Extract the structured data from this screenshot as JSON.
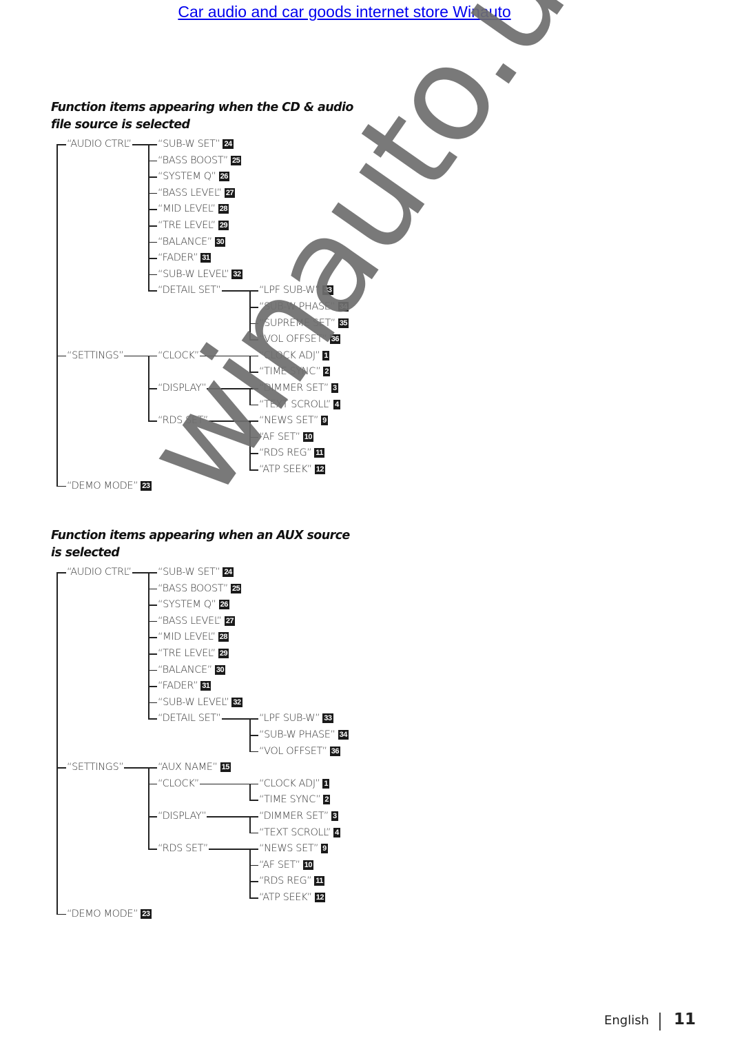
{
  "header": {
    "store_link": "Car audio and car goods internet store Winauto"
  },
  "watermark": "winauto.ua",
  "sections": [
    {
      "title_line1": "Function items appearing when the CD & audio",
      "title_line2": "file source is selected",
      "tree": [
        {
          "label": "“AUDIO CTRL”",
          "children": [
            {
              "label": "“SUB-W SET”",
              "ref": "24"
            },
            {
              "label": "“BASS BOOST”",
              "ref": "25"
            },
            {
              "label": "“SYSTEM Q”",
              "ref": "26"
            },
            {
              "label": "“BASS LEVEL”",
              "ref": "27"
            },
            {
              "label": "“MID LEVEL”",
              "ref": "28"
            },
            {
              "label": "“TRE LEVEL”",
              "ref": "29"
            },
            {
              "label": "“BALANCE”",
              "ref": "30"
            },
            {
              "label": "“FADER”",
              "ref": "31"
            },
            {
              "label": "“SUB-W LEVEL”",
              "ref": "32"
            },
            {
              "label": "“DETAIL SET”",
              "children": [
                {
                  "label": "“LPF SUB-W”",
                  "ref": "33"
                },
                {
                  "label": "“SUB-W PHASE”",
                  "ref": "34"
                },
                {
                  "label": "“SUPREME SET”",
                  "ref": "35"
                },
                {
                  "label": "“VOL OFFSET”",
                  "ref": "36"
                }
              ]
            }
          ]
        },
        {
          "label": "“SETTINGS”",
          "children": [
            {
              "label": "“CLOCK”",
              "children": [
                {
                  "label": "“CLOCK ADJ”",
                  "ref": "1"
                },
                {
                  "label": "“TIME SYNC”",
                  "ref": "2"
                }
              ]
            },
            {
              "label": "“DISPLAY”",
              "children": [
                {
                  "label": "“DIMMER SET”",
                  "ref": "3"
                },
                {
                  "label": "“TEXT SCROLL”",
                  "ref": "4"
                }
              ]
            },
            {
              "label": "“RDS SET”",
              "children": [
                {
                  "label": "“NEWS SET”",
                  "ref": "9"
                },
                {
                  "label": "“AF SET”",
                  "ref": "10"
                },
                {
                  "label": "“RDS REG”",
                  "ref": "11"
                },
                {
                  "label": "“ATP SEEK”",
                  "ref": "12"
                }
              ]
            }
          ]
        },
        {
          "label": "“DEMO MODE”",
          "ref": "23"
        }
      ]
    },
    {
      "title_line1": "Function items appearing when an AUX source",
      "title_line2": "is selected",
      "tree": [
        {
          "label": "“AUDIO CTRL”",
          "children": [
            {
              "label": "“SUB-W SET”",
              "ref": "24"
            },
            {
              "label": "“BASS BOOST”",
              "ref": "25"
            },
            {
              "label": "“SYSTEM Q”",
              "ref": "26"
            },
            {
              "label": "“BASS LEVEL”",
              "ref": "27"
            },
            {
              "label": "“MID LEVEL”",
              "ref": "28"
            },
            {
              "label": "“TRE LEVEL”",
              "ref": "29"
            },
            {
              "label": "“BALANCE”",
              "ref": "30"
            },
            {
              "label": "“FADER”",
              "ref": "31"
            },
            {
              "label": "“SUB-W LEVEL”",
              "ref": "32"
            },
            {
              "label": "“DETAIL SET”",
              "children": [
                {
                  "label": "“LPF SUB-W”",
                  "ref": "33"
                },
                {
                  "label": "“SUB-W PHASE”",
                  "ref": "34"
                },
                {
                  "label": "“VOL OFFSET”",
                  "ref": "36"
                }
              ]
            }
          ]
        },
        {
          "label": "“SETTINGS”",
          "children": [
            {
              "label": "“AUX NAME”",
              "ref": "15"
            },
            {
              "label": "“CLOCK”",
              "children": [
                {
                  "label": "“CLOCK ADJ”",
                  "ref": "1"
                },
                {
                  "label": "“TIME SYNC”",
                  "ref": "2"
                }
              ]
            },
            {
              "label": "“DISPLAY”",
              "children": [
                {
                  "label": "“DIMMER SET”",
                  "ref": "3"
                },
                {
                  "label": "“TEXT SCROLL”",
                  "ref": "4"
                }
              ]
            },
            {
              "label": "“RDS SET”",
              "children": [
                {
                  "label": "“NEWS SET”",
                  "ref": "9"
                },
                {
                  "label": "“AF SET”",
                  "ref": "10"
                },
                {
                  "label": "“RDS REG”",
                  "ref": "11"
                },
                {
                  "label": "“ATP SEEK”",
                  "ref": "12"
                }
              ]
            }
          ]
        },
        {
          "label": "“DEMO MODE”",
          "ref": "23"
        }
      ]
    }
  ],
  "footer": {
    "language": "English",
    "page_number": "11"
  }
}
